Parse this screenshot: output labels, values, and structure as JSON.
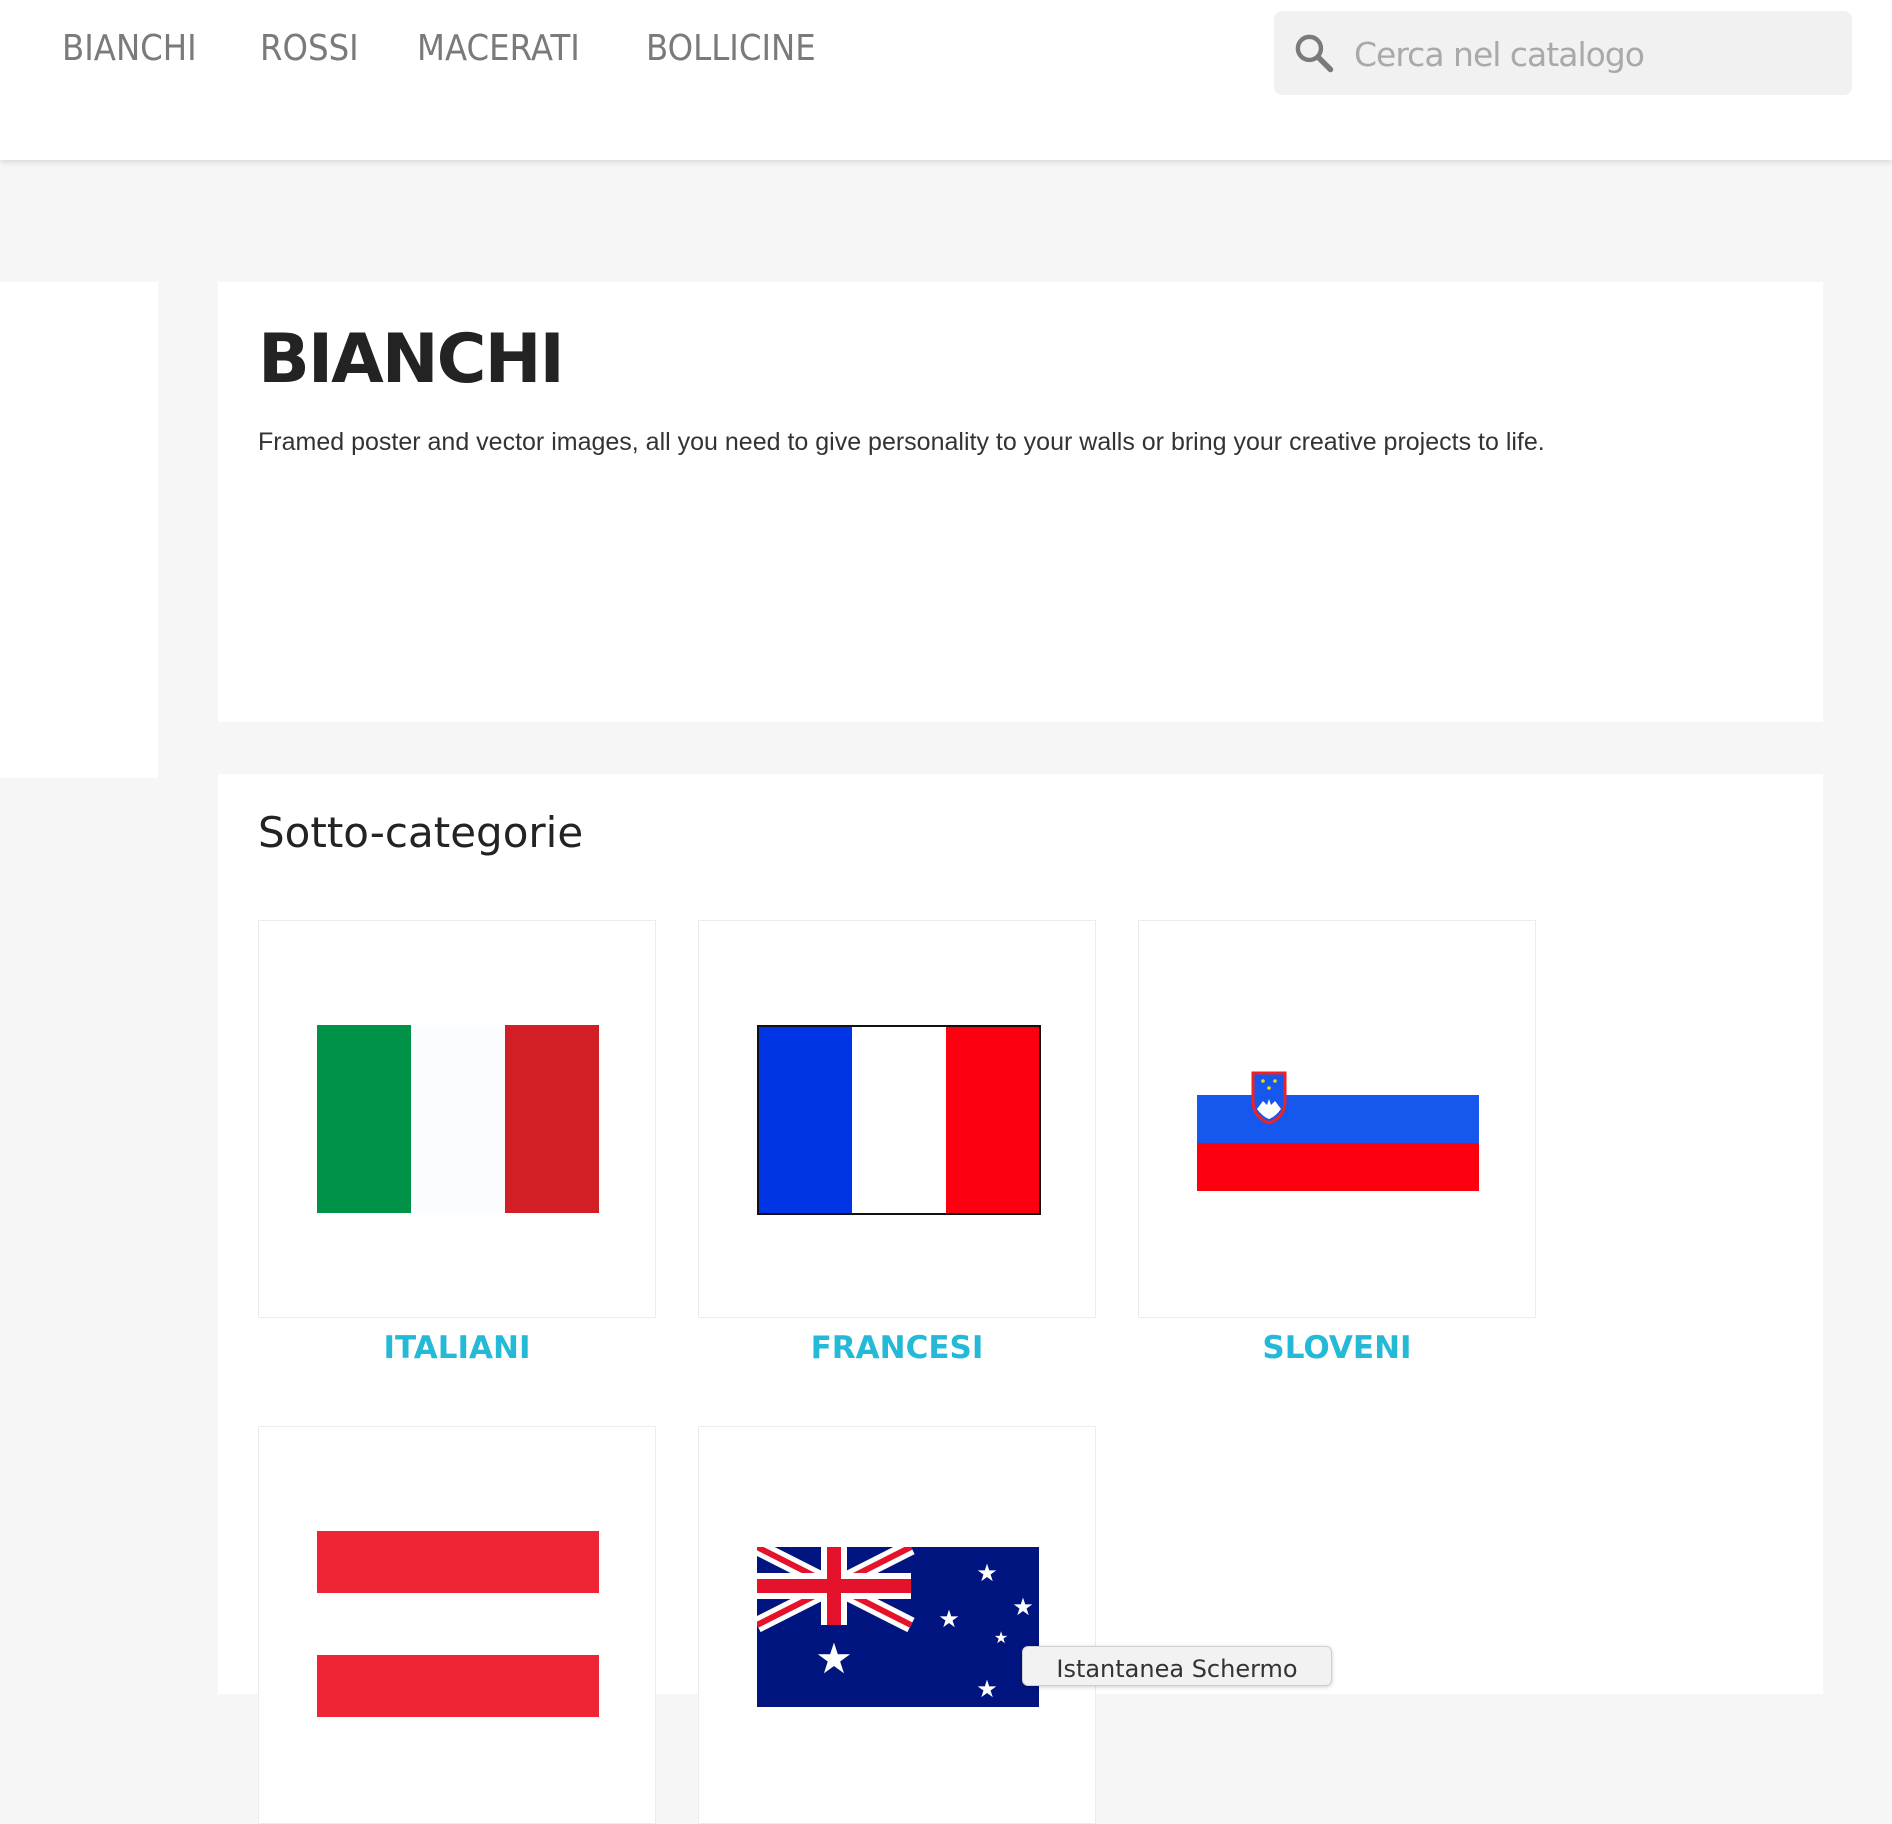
{
  "header": {
    "nav": [
      {
        "label": "BIANCHI"
      },
      {
        "label": "ROSSI"
      },
      {
        "label": "MACERATI"
      },
      {
        "label": "BOLLICINE"
      }
    ],
    "search": {
      "placeholder": "Cerca nel catalogo",
      "icon": "search-icon"
    }
  },
  "category": {
    "title": "BIANCHI",
    "description": "Framed poster and vector images, all you need to give personality to your walls or bring your creative projects to life."
  },
  "subcategories": {
    "heading": "Sotto-categorie",
    "items": [
      {
        "label": "ITALIANI",
        "flag": "italy-flag"
      },
      {
        "label": "FRANCESI",
        "flag": "france-flag"
      },
      {
        "label": "SLOVENI",
        "flag": "slovenia-flag"
      },
      {
        "label": "",
        "flag": "austria-flag"
      },
      {
        "label": "",
        "flag": "australia-flag"
      }
    ]
  },
  "tooltip": {
    "text": "Istantanea Schermo"
  },
  "colors": {
    "link": "#24b9d7",
    "nav_text": "#7a7a7a",
    "page_bg": "#f6f6f6"
  }
}
